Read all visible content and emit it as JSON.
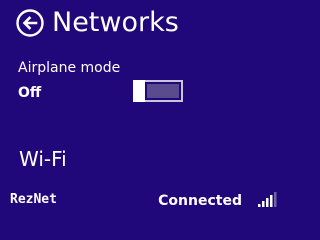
{
  "header": {
    "title": "Networks",
    "back_icon": "back-arrow-circle-icon"
  },
  "airplane_mode": {
    "label": "Airplane mode",
    "state_label": "Off",
    "enabled": false
  },
  "wifi": {
    "heading": "Wi-Fi",
    "networks": [
      {
        "name": "RezNet",
        "status": "Connected",
        "signal_icon": "wifi-signal-bars-icon",
        "signal_bars": 4,
        "signal_bars_total": 5
      }
    ]
  },
  "colors": {
    "background": "#21087a",
    "text": "#ffffff",
    "toggle_track": "#5a4b8f",
    "toggle_border": "#c8c4dc",
    "signal_inactive": "#6f63a6"
  }
}
